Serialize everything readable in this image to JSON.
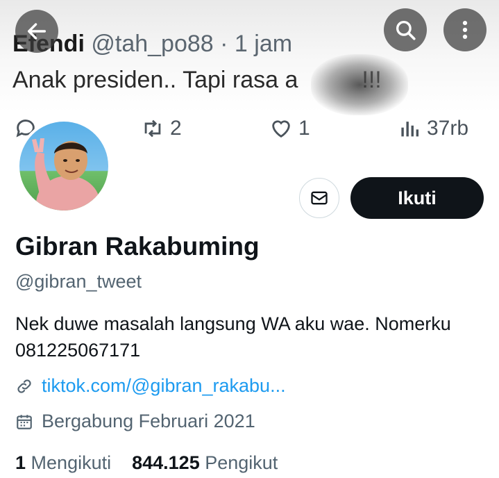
{
  "tweet": {
    "author": "Efendi",
    "handle": "@tah_po88",
    "separator": "·",
    "time": "1 jam",
    "text": "Anak presiden.. Tapi rasa a",
    "text_end": "!!!",
    "retweets": "2",
    "likes": "1",
    "views": "37rb"
  },
  "nav": {
    "back_icon": "arrow-left-icon",
    "search_icon": "search-icon",
    "more_icon": "more-vertical-icon"
  },
  "profile": {
    "display_name": "Gibran Rakabuming",
    "handle": "@gibran_tweet",
    "bio_line1": "Nek duwe masalah langsung WA aku wae. Nomerku",
    "bio_line2": "081225067171",
    "link": "tiktok.com/@gibran_rakabu...",
    "joined": "Bergabung Februari 2021",
    "follow_label": "Ikuti",
    "following_count": "1",
    "following_label": "Mengikuti",
    "followers_count": "844.125",
    "followers_label": "Pengikut"
  },
  "colors": {
    "accent": "#1d9bf0",
    "follow_bg": "#0f1419",
    "muted": "#536471"
  }
}
